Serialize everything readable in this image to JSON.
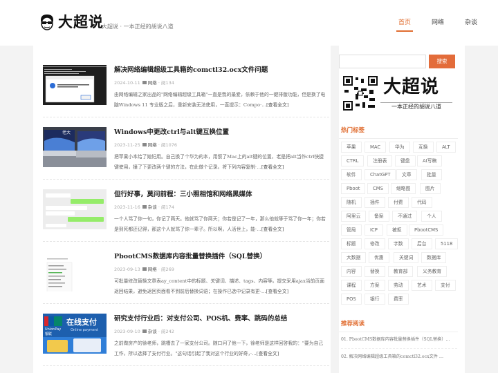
{
  "header": {
    "logo_text": "大超说",
    "tagline": "大超说 · 一本正经的胡说八道",
    "nav": [
      {
        "label": "首页",
        "active": true
      },
      {
        "label": "网络",
        "active": false
      },
      {
        "label": "杂谈",
        "active": false
      }
    ]
  },
  "articles": [
    {
      "title": "解决网络编辑超级工具箱的comctl32.ocx文件问题",
      "date": "2024-10-11",
      "category": "网络",
      "views": "134",
      "excerpt": "由网络编辑之家出品的\"网络编辑超级工具箱\"一直是我的最爱，依赖于他的一键排版功能，但是换了电脑Windows 11 专业版之后，重新安装无法使用，一直提示：Compo·…",
      "more": "[查看全文]",
      "thumb": "dialog"
    },
    {
      "title": "Windows中更改ctrl与alt键互换位置",
      "date": "2023-11-25",
      "category": "网络",
      "views": "1076",
      "excerpt": "把苹果小本给了媳妇用。自己换了个华为的本，用惯了Mac上的alt键的位置，老是把alt当作ctrl快捷键使用，撞了下更改两个键的方法，在此做个记录。将下列内容复制·…",
      "more": "[查看全文]",
      "thumb": "laptop"
    },
    {
      "title": "但行好事，莫问前程：三小照相馆和网络黑媒体",
      "date": "2023-11-16",
      "category": "杂谈",
      "views": "174",
      "excerpt": "一个人骂了你一句，你记了两天。他就骂了你两天；你若是记了一年，那么他就等于骂了你一年；你若是到死都还记得，那这个人就骂了你一辈子。所以啊，人活世上，能·…",
      "more": "[查看全文]",
      "thumb": "chat"
    },
    {
      "title": "PbootCMS数据库内容批量替换插件（SQL替换）",
      "date": "2023-09-13",
      "category": "网络",
      "views": "269",
      "excerpt": "可批量修改替换文章表ay_content中的标题、关键词、描述、tags、内容等。提交采用ajax当前页面返回结果，避免返回页面看不到前后替换词语；在操作已选中记录有更·…",
      "more": "[查看全文]",
      "thumb": "menu"
    },
    {
      "title": "研究支付行业后：对支付公司、POS机、费率、跳码的总结",
      "date": "2023-09-10",
      "category": "杂谈",
      "views": "242",
      "excerpt": "之前做房产的徐老师，跳槽去了一家支付公司。随口问了他一下，徐老师是这样回答我的：\"要为自己工作，所以选择了支付行业。\"这句话引起了我对这个行业的好奇，·…",
      "more": "[查看全文]",
      "thumb": "pay"
    }
  ],
  "thumb_text": {
    "laptop_caption": "老大",
    "pay_line1": "UnionPay",
    "pay_line2": "银联",
    "pay_line3": "在线支付",
    "pay_line4": "Online payment"
  },
  "sidebar": {
    "search_button": "搜索",
    "brand_text": "大超说",
    "brand_tag": "一本正经的胡说八道",
    "hot_tags_title": "热门标签",
    "tags": [
      "苹果",
      "MAC",
      "华为",
      "互换",
      "ALT",
      "CTRL",
      "注册表",
      "键盘",
      "AI写稿",
      "软件",
      "ChatGPT",
      "文章",
      "批量",
      "Pboot",
      "CMS",
      "缩略图",
      "图片",
      "随机",
      "插件",
      "付费",
      "代码",
      "阿里云",
      "备案",
      "不通过",
      "个人",
      "管局",
      "ICP",
      "被拒",
      "PbootCMS",
      "标题",
      "修改",
      "字数",
      "后台",
      "5118",
      "大数据",
      "优惠",
      "关键词",
      "数据库",
      "内容",
      "替换",
      "教育部",
      "义务教育",
      "课程",
      "方案",
      "劳动",
      "艺术",
      "支付",
      "POS",
      "银行",
      "费率"
    ],
    "recommended_title": "推荐阅读",
    "recommended": [
      "01. PbootCMS数据库内容批量替换插件（SQL替换）…",
      "02. 解决网络编辑超级工具箱的comctl32.ocx文件 …"
    ]
  },
  "colors": {
    "accent": "#e06c2f",
    "search_button": "#e36c3a"
  }
}
